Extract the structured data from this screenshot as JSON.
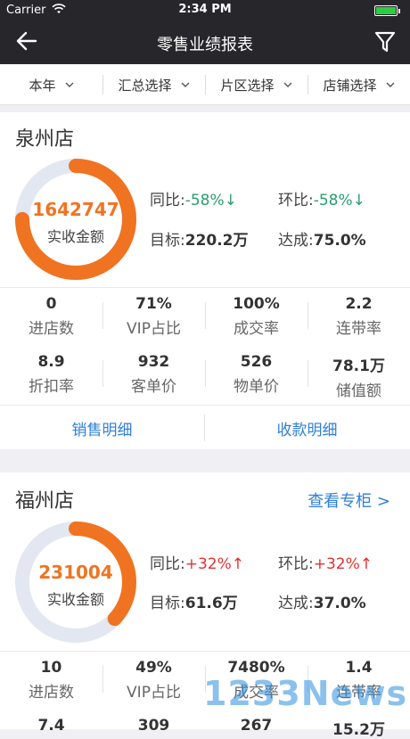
{
  "status_bar": {
    "carrier": "Carrier",
    "time": "2:34 PM"
  },
  "navbar": {
    "title": "零售业绩报表"
  },
  "filters": [
    {
      "label": "本年"
    },
    {
      "label": "汇总选择"
    },
    {
      "label": "片区选择"
    },
    {
      "label": "店铺选择"
    }
  ],
  "stores": [
    {
      "name": "泉州店",
      "amount": "1642747",
      "amount_label": "实收金额",
      "progress": 0.75,
      "yoy_label": "同比:",
      "yoy_value": "-58%↓",
      "mom_label": "环比:",
      "mom_value": "-58%↓",
      "target_label": "目标:",
      "target_value": "220.2万",
      "achieve_label": "达成:",
      "achieve_value": "75.0%",
      "metrics": [
        {
          "value": "0",
          "label": "进店数"
        },
        {
          "value": "71%",
          "label": "VIP占比"
        },
        {
          "value": "100%",
          "label": "成交率"
        },
        {
          "value": "2.2",
          "label": "连带率"
        },
        {
          "value": "8.9",
          "label": "折扣率"
        },
        {
          "value": "932",
          "label": "客单价"
        },
        {
          "value": "526",
          "label": "物单价"
        },
        {
          "value": "78.1万",
          "label": "储值额"
        }
      ],
      "sales_detail": "销售明细",
      "payment_detail": "收款明细"
    },
    {
      "name": "福州店",
      "view_counter": "查看专柜 >",
      "amount": "231004",
      "amount_label": "实收金额",
      "progress": 0.37,
      "yoy_label": "同比:",
      "yoy_value": "+32%↑",
      "mom_label": "环比:",
      "mom_value": "+32%↑",
      "target_label": "目标:",
      "target_value": "61.6万",
      "achieve_label": "达成:",
      "achieve_value": "37.0%",
      "metrics": [
        {
          "value": "10",
          "label": "进店数"
        },
        {
          "value": "49%",
          "label": "VIP占比"
        },
        {
          "value": "7480%",
          "label": "成交率"
        },
        {
          "value": "1.4",
          "label": "连带率"
        },
        {
          "value": "7.4",
          "label": ""
        },
        {
          "value": "309",
          "label": ""
        },
        {
          "value": "267",
          "label": ""
        },
        {
          "value": "15.2万",
          "label": ""
        }
      ]
    }
  ],
  "watermark": "1233News",
  "colors": {
    "accent_orange": "#f07321",
    "link_blue": "#2f7fd8",
    "down_green": "#2a9d6f",
    "up_red": "#e0322f",
    "nav_dark": "#26262b"
  }
}
